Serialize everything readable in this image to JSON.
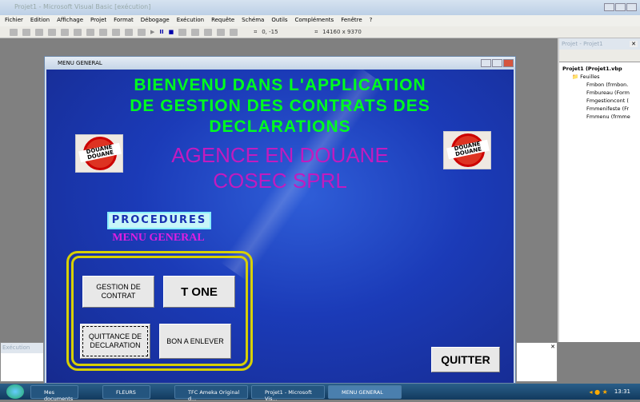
{
  "ide": {
    "title": "Projet1 - Microsoft Visual Basic [exécution]",
    "menu": [
      "Fichier",
      "Edition",
      "Affichage",
      "Projet",
      "Format",
      "Débogage",
      "Exécution",
      "Requête",
      "Schéma",
      "Outils",
      "Compléments",
      "Fenêtre",
      "?"
    ],
    "position": "0, -15",
    "size": "14160 x 9370"
  },
  "project": {
    "title": "Projet - Projet1",
    "root": "Projet1 (Projet1.vbp",
    "folder": "Feuilles",
    "forms": [
      "Fmbon (frmbon.",
      "Fmbureau (Form",
      "Fmgestioncont (",
      "Fmmenifeste (Fr",
      "Fmmenu (frmme"
    ]
  },
  "exec_panel": {
    "title": "Exécution"
  },
  "form": {
    "title": "MENU GENERAL",
    "headline": [
      "BIENVENU DANS L'APPLICATION",
      "DE GESTION DES CONTRATS DES",
      "DECLARATIONS"
    ],
    "agency": [
      "AGENCE EN DOUANE",
      "COSEC SPRL"
    ],
    "logo_text": [
      "DOUANE",
      "DOUANE"
    ],
    "procedures": "PROCEDURES",
    "menu_general": "MENU GENERAL",
    "buttons": {
      "gestion": "GESTION DE CONTRAT",
      "tone": "T ONE",
      "quittance": "QUITTANCE DE DECLARATION",
      "bon": "BON A ENLEVER",
      "quitter": "QUITTER"
    }
  },
  "taskbar": {
    "items": [
      "Mes documents",
      "FLEURS",
      "TFC Ameka Original d...",
      "Projet1 - Microsoft Vis...",
      "MENU GENERAL"
    ],
    "clock": "13:31"
  }
}
